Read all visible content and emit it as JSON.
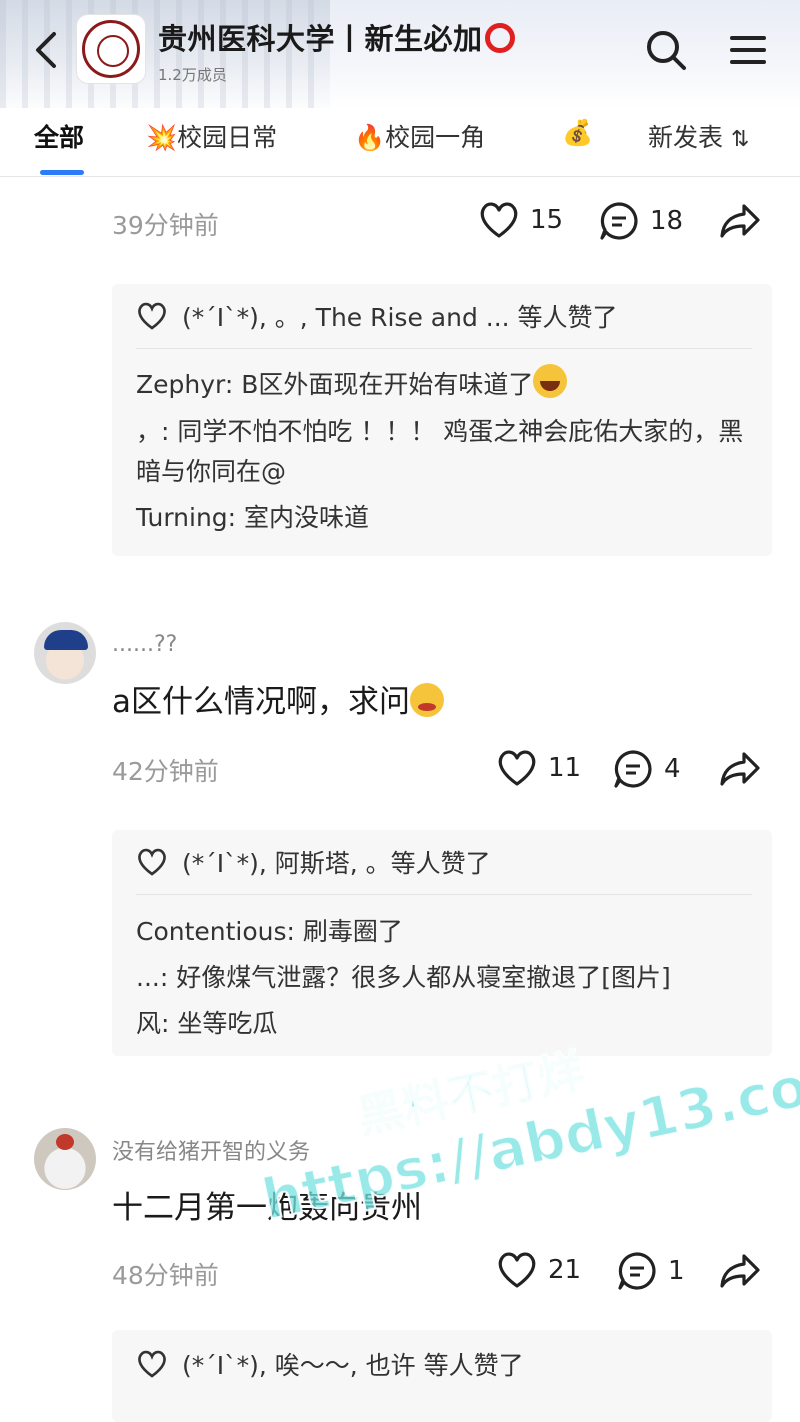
{
  "header": {
    "title": "贵州医科大学丨新生必加",
    "member_count": "1.2万成员"
  },
  "tabs": [
    {
      "label": "全部",
      "active": true
    },
    {
      "label": "💥校园日常",
      "active": false
    },
    {
      "label": "🔥校园一角",
      "active": false
    },
    {
      "label": "💰",
      "active": false
    },
    {
      "label": "新发表",
      "active": false
    },
    {
      "label": "⇅",
      "active": false
    }
  ],
  "posts": [
    {
      "time": "39分钟前",
      "likes": "15",
      "comments": "18",
      "liked_by": "(*´I`*), 。, The Rise and ... 等人赞了",
      "replies": [
        {
          "author": "Zephyr:",
          "text": "B区外面现在开始有味道了"
        },
        {
          "author": "，:",
          "text": "同学不怕不怕吃 ！！！ 鸡蛋之神会庇佑大家的，黑暗与你同在@"
        },
        {
          "author": "Turning:",
          "text": "室内没味道"
        }
      ]
    },
    {
      "username": "......??",
      "text": "a区什么情况啊，求问",
      "time": "42分钟前",
      "likes": "11",
      "comments": "4",
      "liked_by": "(*´I`*), 阿斯塔, 。等人赞了",
      "replies": [
        {
          "author": "Contentious:",
          "text": "刷毒圈了"
        },
        {
          "author": "...:",
          "text": "好像煤气泄露？很多人都从寝室撤退了[图片]"
        },
        {
          "author": "风:",
          "text": "坐等吃瓜"
        }
      ]
    },
    {
      "username": "没有给猪开智的义务",
      "text": "十二月第一炮轰向贵州",
      "time": "48分钟前",
      "likes": "21",
      "comments": "1",
      "liked_by": "(*´I`*), 唉～～, 也许 等人赞了"
    }
  ],
  "watermark": {
    "line1": "黑料不打烊",
    "line2": "https://abdy13.com"
  },
  "colors": {
    "accent": "#2b7cf6",
    "ring": "#e02020",
    "reply_bg": "#f7f7f7"
  }
}
